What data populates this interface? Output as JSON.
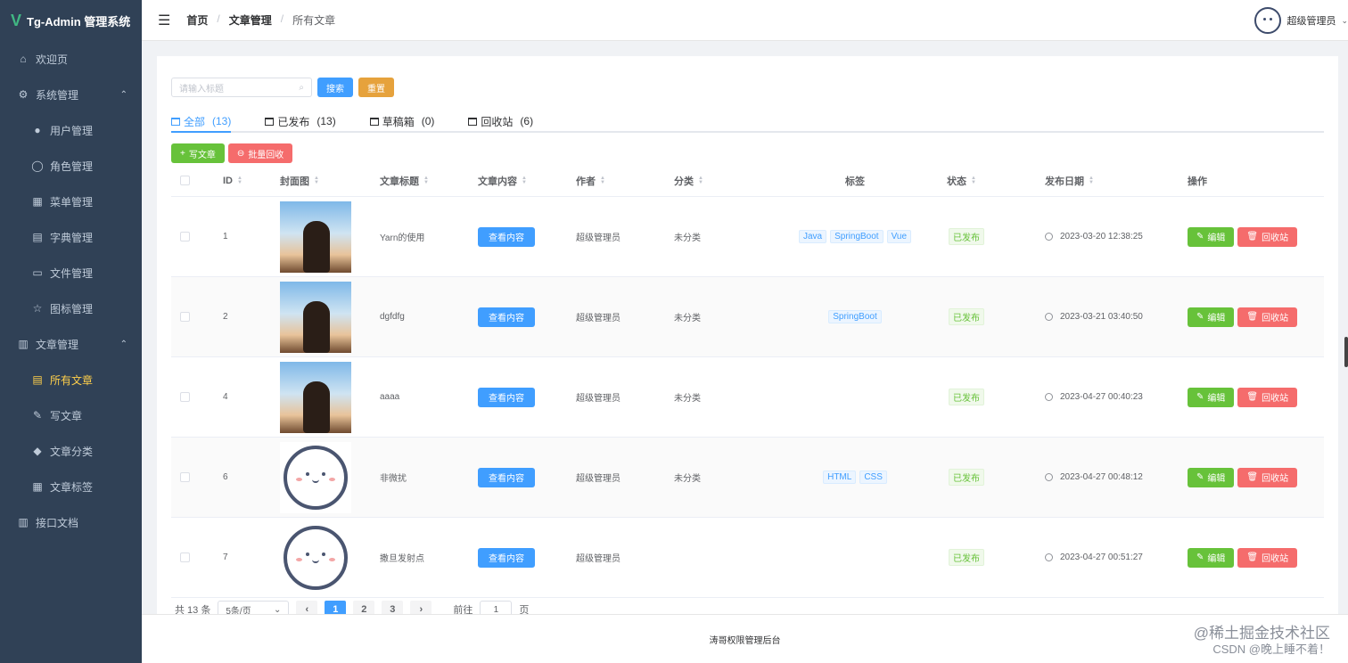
{
  "app": {
    "logo_mark": "V",
    "title": "Tg-Admin 管理系统"
  },
  "sidebar": {
    "items": [
      {
        "label": "欢迎页",
        "icon": "home-icon"
      },
      {
        "label": "系统管理",
        "icon": "gear-icon",
        "expanded": true
      },
      {
        "label": "用户管理",
        "icon": "user-icon",
        "sub": true
      },
      {
        "label": "角色管理",
        "icon": "role-icon",
        "sub": true
      },
      {
        "label": "菜单管理",
        "icon": "grid-icon",
        "sub": true
      },
      {
        "label": "字典管理",
        "icon": "book-icon",
        "sub": true
      },
      {
        "label": "文件管理",
        "icon": "folder-icon",
        "sub": true
      },
      {
        "label": "图标管理",
        "icon": "star-icon",
        "sub": true
      },
      {
        "label": "文章管理",
        "icon": "document-icon",
        "expanded": true
      },
      {
        "label": "所有文章",
        "icon": "list-icon",
        "sub": true,
        "active": true
      },
      {
        "label": "写文章",
        "icon": "edit-icon",
        "sub": true
      },
      {
        "label": "文章分类",
        "icon": "bell-icon",
        "sub": true
      },
      {
        "label": "文章标签",
        "icon": "apps-icon",
        "sub": true
      },
      {
        "label": "接口文档",
        "icon": "doc-icon"
      }
    ]
  },
  "header": {
    "breadcrumb": [
      "首页",
      "文章管理",
      "所有文章"
    ],
    "user_name": "超级管理员"
  },
  "search": {
    "placeholder": "请输入标题",
    "search_label": "搜索",
    "reset_label": "重置"
  },
  "tabs": [
    {
      "label": "全部",
      "count": "(13)",
      "active": true
    },
    {
      "label": "已发布",
      "count": "(13)"
    },
    {
      "label": "草稿箱",
      "count": "(0)"
    },
    {
      "label": "回收站",
      "count": "(6)"
    }
  ],
  "actions": {
    "write_label": "写文章",
    "batch_recycle_label": "批量回收"
  },
  "table": {
    "headers": {
      "id": "ID",
      "cover": "封面图",
      "title": "文章标题",
      "content": "文章内容",
      "author": "作者",
      "category": "分类",
      "tags": "标签",
      "status": "状态",
      "date": "发布日期",
      "ops": "操作"
    },
    "rows": [
      {
        "id": "1",
        "cover": "photo",
        "title": "Yarn的使用",
        "content_btn": "查看内容",
        "author": "超级管理员",
        "category": "未分类",
        "tags": [
          "Java",
          "SpringBoot",
          "Vue"
        ],
        "status": "已发布",
        "date": "2023-03-20 12:38:25",
        "edit": "编辑",
        "recycle": "回收站"
      },
      {
        "id": "2",
        "cover": "photo",
        "title": "dgfdfg",
        "content_btn": "查看内容",
        "author": "超级管理员",
        "category": "未分类",
        "tags": [
          "SpringBoot"
        ],
        "status": "已发布",
        "date": "2023-03-21 03:40:50",
        "edit": "编辑",
        "recycle": "回收站"
      },
      {
        "id": "4",
        "cover": "photo",
        "title": "aaaa",
        "content_btn": "查看内容",
        "author": "超级管理员",
        "category": "未分类",
        "tags": [],
        "status": "已发布",
        "date": "2023-04-27 00:40:23",
        "edit": "编辑",
        "recycle": "回收站"
      },
      {
        "id": "6",
        "cover": "face",
        "title": "非微扰",
        "content_btn": "查看内容",
        "author": "超级管理员",
        "category": "未分类",
        "tags": [
          "HTML",
          "CSS"
        ],
        "status": "已发布",
        "date": "2023-04-27 00:48:12",
        "edit": "编辑",
        "recycle": "回收站"
      },
      {
        "id": "7",
        "cover": "face",
        "title": "撒旦发射点",
        "content_btn": "查看内容",
        "author": "超级管理员",
        "category": "",
        "tags": [],
        "status": "已发布",
        "date": "2023-04-27 00:51:27",
        "edit": "编辑",
        "recycle": "回收站"
      }
    ]
  },
  "pagination": {
    "total": "共 13 条",
    "page_size": "5条/页",
    "pages": [
      "1",
      "2",
      "3"
    ],
    "current": "1",
    "prev": "‹",
    "next": "›",
    "goto_label": "前往",
    "goto_value": "1",
    "goto_suffix": "页"
  },
  "footer": {
    "text": "涛哥权限管理后台"
  },
  "watermark": {
    "line1": "@稀土掘金技术社区",
    "line2": "CSDN @晚上睡不着！"
  },
  "colors": {
    "primary": "#409eff",
    "success": "#67c23a",
    "warning": "#e6a23c",
    "danger": "#f56c6c",
    "sidebar": "#304156",
    "active_menu": "#ffd04b"
  }
}
